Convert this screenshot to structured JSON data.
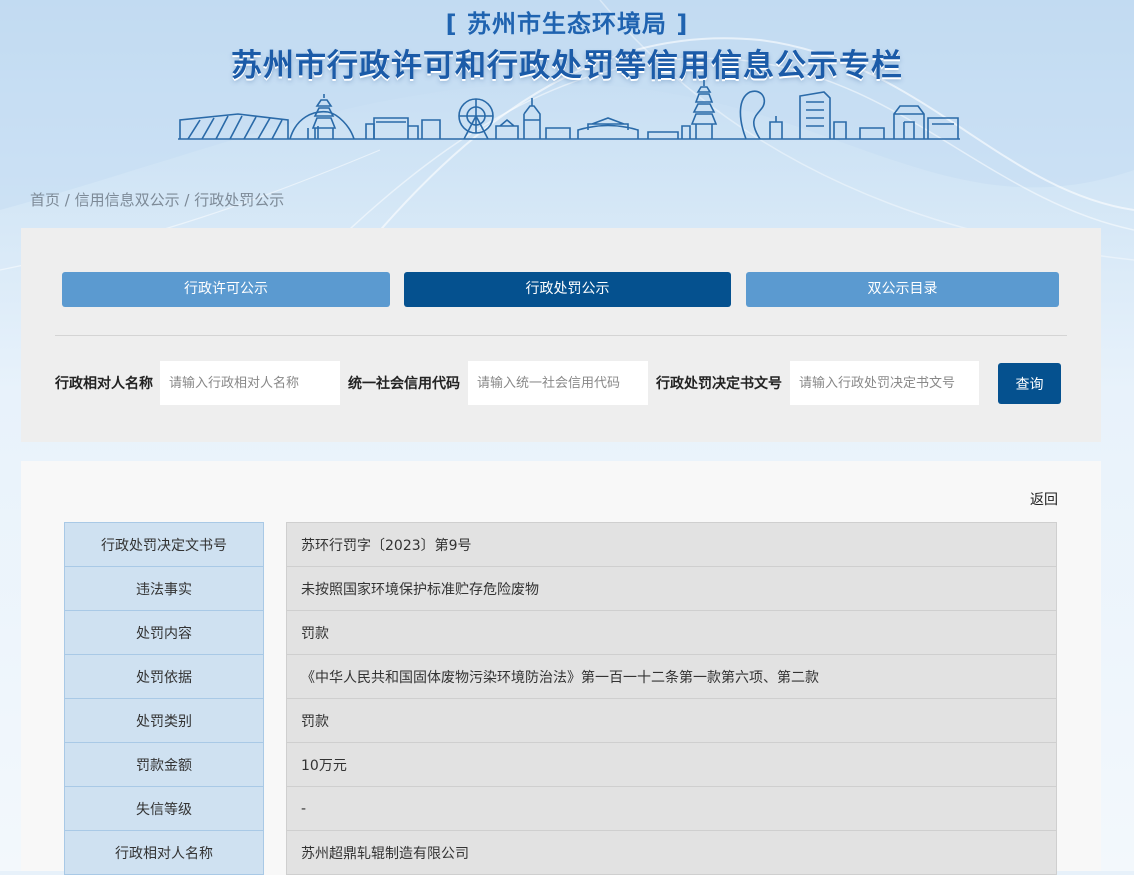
{
  "header": {
    "subtitle": "[ 苏州市生态环境局 ]",
    "title": "苏州市行政许可和行政处罚等信用信息公示专栏"
  },
  "breadcrumb": {
    "home": "首页",
    "sep1": " / ",
    "section": "信用信息双公示",
    "sep2": " / ",
    "current": "行政处罚公示"
  },
  "tabs": [
    {
      "label": "行政许可公示",
      "active": false
    },
    {
      "label": "行政处罚公示",
      "active": true
    },
    {
      "label": "双公示目录",
      "active": false
    }
  ],
  "search": {
    "fields": [
      {
        "label": "行政相对人名称",
        "placeholder": "请输入行政相对人名称",
        "value": ""
      },
      {
        "label": "统一社会信用代码",
        "placeholder": "请输入统一社会信用代码",
        "value": ""
      },
      {
        "label": "行政处罚决定书文号",
        "placeholder": "请输入行政处罚决定书文号",
        "value": ""
      }
    ],
    "button": "查询"
  },
  "detail": {
    "back": "返回",
    "rows": [
      {
        "label": "行政处罚决定文书号",
        "value": "苏环行罚字〔2023〕第9号"
      },
      {
        "label": "违法事实",
        "value": "未按照国家环境保护标准贮存危险废物"
      },
      {
        "label": "处罚内容",
        "value": "罚款"
      },
      {
        "label": "处罚依据",
        "value": "《中华人民共和国固体废物污染环境防治法》第一百一十二条第一款第六项、第二款"
      },
      {
        "label": "处罚类别",
        "value": "罚款"
      },
      {
        "label": "罚款金额",
        "value": "10万元"
      },
      {
        "label": "失信等级",
        "value": "-"
      },
      {
        "label": "行政相对人名称",
        "value": "苏州超鼎轧辊制造有限公司"
      }
    ]
  },
  "colors": {
    "primary": "#05518f",
    "tab_inactive": "#5b9ad0",
    "label_cell": "#cfe1f1",
    "value_cell": "#e2e2e2"
  }
}
